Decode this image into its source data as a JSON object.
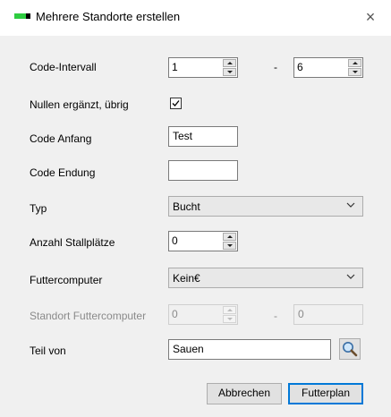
{
  "window": {
    "title": "Mehrere Standorte erstellen",
    "close_glyph": "×",
    "icon": "app-icon"
  },
  "fields": {
    "code_intervall": {
      "label": "Code-Intervall",
      "from": "1",
      "separator": "-",
      "to": "6"
    },
    "nullen": {
      "label": "Nullen ergänzt, übrig",
      "checked": true
    },
    "code_anfang": {
      "label": "Code Anfang",
      "value": "Test"
    },
    "code_endung": {
      "label": "Code Endung",
      "value": ""
    },
    "typ": {
      "label": "Typ",
      "value": "Bucht"
    },
    "anzahl_stallplaetze": {
      "label": "Anzahl Stallplätze",
      "value": "0"
    },
    "futtercomputer": {
      "label": "Futtercomputer",
      "value": "Kein€"
    },
    "standort_futtercomputer": {
      "label": "Standort Futtercomputer",
      "from": "0",
      "separator": "-",
      "to": "0",
      "enabled": false
    },
    "teil_von": {
      "label": "Teil von",
      "value": "Sauen",
      "search_icon": "magnifier-icon"
    }
  },
  "buttons": {
    "cancel": "Abbrechen",
    "primary": "Futterplan"
  },
  "colors": {
    "accent": "#0078d7",
    "icon_green": "#2ecc40"
  }
}
